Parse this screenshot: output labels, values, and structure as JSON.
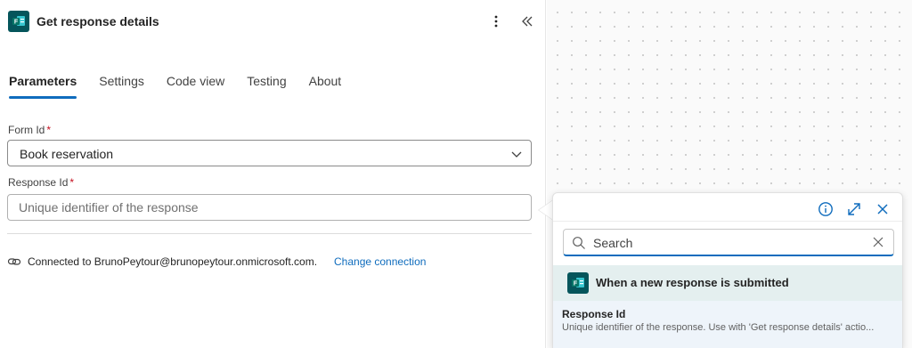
{
  "panel": {
    "title": "Get response details",
    "tabs": [
      {
        "label": "Parameters",
        "active": true
      },
      {
        "label": "Settings",
        "active": false
      },
      {
        "label": "Code view",
        "active": false
      },
      {
        "label": "Testing",
        "active": false
      },
      {
        "label": "About",
        "active": false
      }
    ],
    "form_id": {
      "label": "Form Id",
      "required_mark": "*",
      "value": "Book reservation"
    },
    "response_id": {
      "label": "Response Id",
      "required_mark": "*",
      "placeholder": "Unique identifier of the response",
      "value": ""
    },
    "connection": {
      "text": "Connected to BrunoPeytour@brunopeytour.onmicrosoft.com.",
      "change_link": "Change connection"
    }
  },
  "popup": {
    "search": {
      "placeholder": "Search",
      "value": ""
    },
    "trigger": {
      "label": "When a new response is submitted",
      "icon": "forms-icon"
    },
    "token": {
      "title": "Response Id",
      "description": "Unique identifier of the response. Use with 'Get response details' actio..."
    }
  },
  "icons": {
    "more": "more-vertical-icon",
    "collapse": "double-chevron-left-icon",
    "info": "info-icon",
    "expand": "expand-icon",
    "close": "close-icon",
    "search": "search-icon",
    "clear": "clear-icon",
    "connection": "link-icon",
    "dropdown": "chevron-down-icon"
  },
  "colors": {
    "accent": "#0f6cbd",
    "forms_brand": "#05555b",
    "required": "#c50f1f",
    "trigger_row_bg": "#e4efef"
  }
}
